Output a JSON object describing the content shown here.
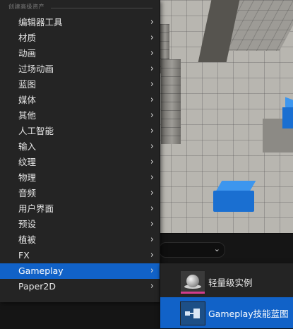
{
  "menu": {
    "header": "创建高级资产",
    "items": [
      {
        "label": "编辑器工具",
        "has_submenu": true
      },
      {
        "label": "材质",
        "has_submenu": true
      },
      {
        "label": "动画",
        "has_submenu": true
      },
      {
        "label": "过场动画",
        "has_submenu": true
      },
      {
        "label": "蓝图",
        "has_submenu": true
      },
      {
        "label": "媒体",
        "has_submenu": true
      },
      {
        "label": "其他",
        "has_submenu": true
      },
      {
        "label": "人工智能",
        "has_submenu": true
      },
      {
        "label": "输入",
        "has_submenu": true
      },
      {
        "label": "纹理",
        "has_submenu": true
      },
      {
        "label": "物理",
        "has_submenu": true
      },
      {
        "label": "音频",
        "has_submenu": true
      },
      {
        "label": "用户界面",
        "has_submenu": true
      },
      {
        "label": "预设",
        "has_submenu": true
      },
      {
        "label": "植被",
        "has_submenu": true
      },
      {
        "label": "FX",
        "has_submenu": true
      },
      {
        "label": "Gameplay",
        "has_submenu": true,
        "active": true
      },
      {
        "label": "Paper2D",
        "has_submenu": true
      }
    ]
  },
  "submenu": {
    "items": [
      {
        "label": "轻量级实例",
        "icon": "sphere-thumbnail-icon"
      },
      {
        "label": "Gameplay技能蓝图",
        "icon": "blueprint-thumbnail-icon",
        "active": true
      }
    ]
  },
  "icons": {
    "submenu_arrow": "chevron-right-icon",
    "dropdown": "chevron-down-icon"
  },
  "colors": {
    "highlight": "#1162c8",
    "menu_bg": "#242424",
    "viewport_floor": "#b8b6b0",
    "cube": "#1a6fd1"
  }
}
